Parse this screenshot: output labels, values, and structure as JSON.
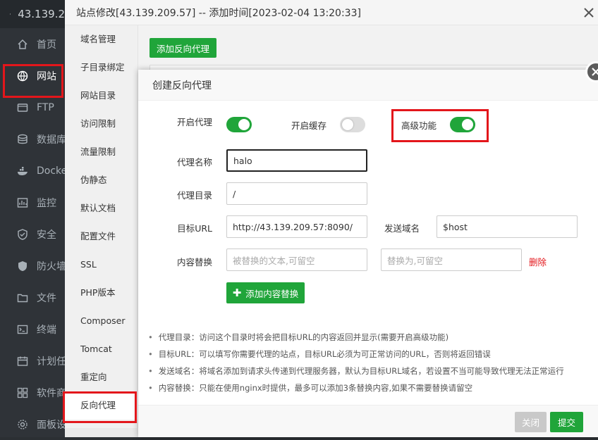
{
  "app": {
    "host": "43.139.2",
    "nav": [
      {
        "label": "首页",
        "icon": "home-icon"
      },
      {
        "label": "网站",
        "icon": "globe-icon"
      },
      {
        "label": "FTP",
        "icon": "ftp-icon"
      },
      {
        "label": "数据库",
        "icon": "database-icon"
      },
      {
        "label": "Docker",
        "icon": "docker-icon"
      },
      {
        "label": "监控",
        "icon": "monitor-icon"
      },
      {
        "label": "安全",
        "icon": "security-icon"
      },
      {
        "label": "防火墙",
        "icon": "firewall-icon"
      },
      {
        "label": "文件",
        "icon": "folder-icon"
      },
      {
        "label": "终端",
        "icon": "terminal-icon"
      },
      {
        "label": "计划任务",
        "icon": "calendar-icon"
      },
      {
        "label": "软件商店",
        "icon": "apps-icon"
      },
      {
        "label": "面板设置",
        "icon": "settings-icon"
      }
    ]
  },
  "modal": {
    "title": "站点修改[43.139.209.57] -- 添加时间[2023-02-04 13:20:33]",
    "menu": [
      "域名管理",
      "子目录绑定",
      "网站目录",
      "访问限制",
      "流量限制",
      "伪静态",
      "默认文档",
      "配置文件",
      "SSL",
      "PHP版本",
      "Composer",
      "Tomcat",
      "重定向",
      "反向代理"
    ],
    "add_proxy_label": "添加反向代理"
  },
  "dialog": {
    "title": "创建反向代理",
    "enable_proxy_label": "开启代理",
    "enable_cache_label": "开启缓存",
    "advanced_label": "高级功能",
    "proxy_name_label": "代理名称",
    "proxy_name_value": "halo",
    "proxy_dir_label": "代理目录",
    "proxy_dir_value": "/",
    "target_url_label": "目标URL",
    "target_url_value": "http://43.139.209.57:8090/",
    "send_domain_label": "发送域名",
    "send_domain_value": "$host",
    "content_replace_label": "内容替换",
    "replace_from_placeholder": "被替换的文本,可留空",
    "replace_to_placeholder": "替换为,可留空",
    "delete_label": "删除",
    "add_content_label": "添加内容替换",
    "tips": [
      "代理目录：访问这个目录时将会把目标URL的内容返回并显示(需要开启高级功能)",
      "目标URL：可以填写你需要代理的站点，目标URL必须为可正常访问的URL，否则将返回错误",
      "发送域名：将域名添加到请求头传递到代理服务器，默认为目标URL域名，若设置不当可能导致代理无法正常运行",
      "内容替换：只能在使用nginx时提供，最多可以添加3条替换内容,如果不需要替换请留空"
    ],
    "close_label": "关闭",
    "submit_label": "提交"
  },
  "colors": {
    "accent": "#20a53a",
    "highlight": "#e3161b"
  }
}
